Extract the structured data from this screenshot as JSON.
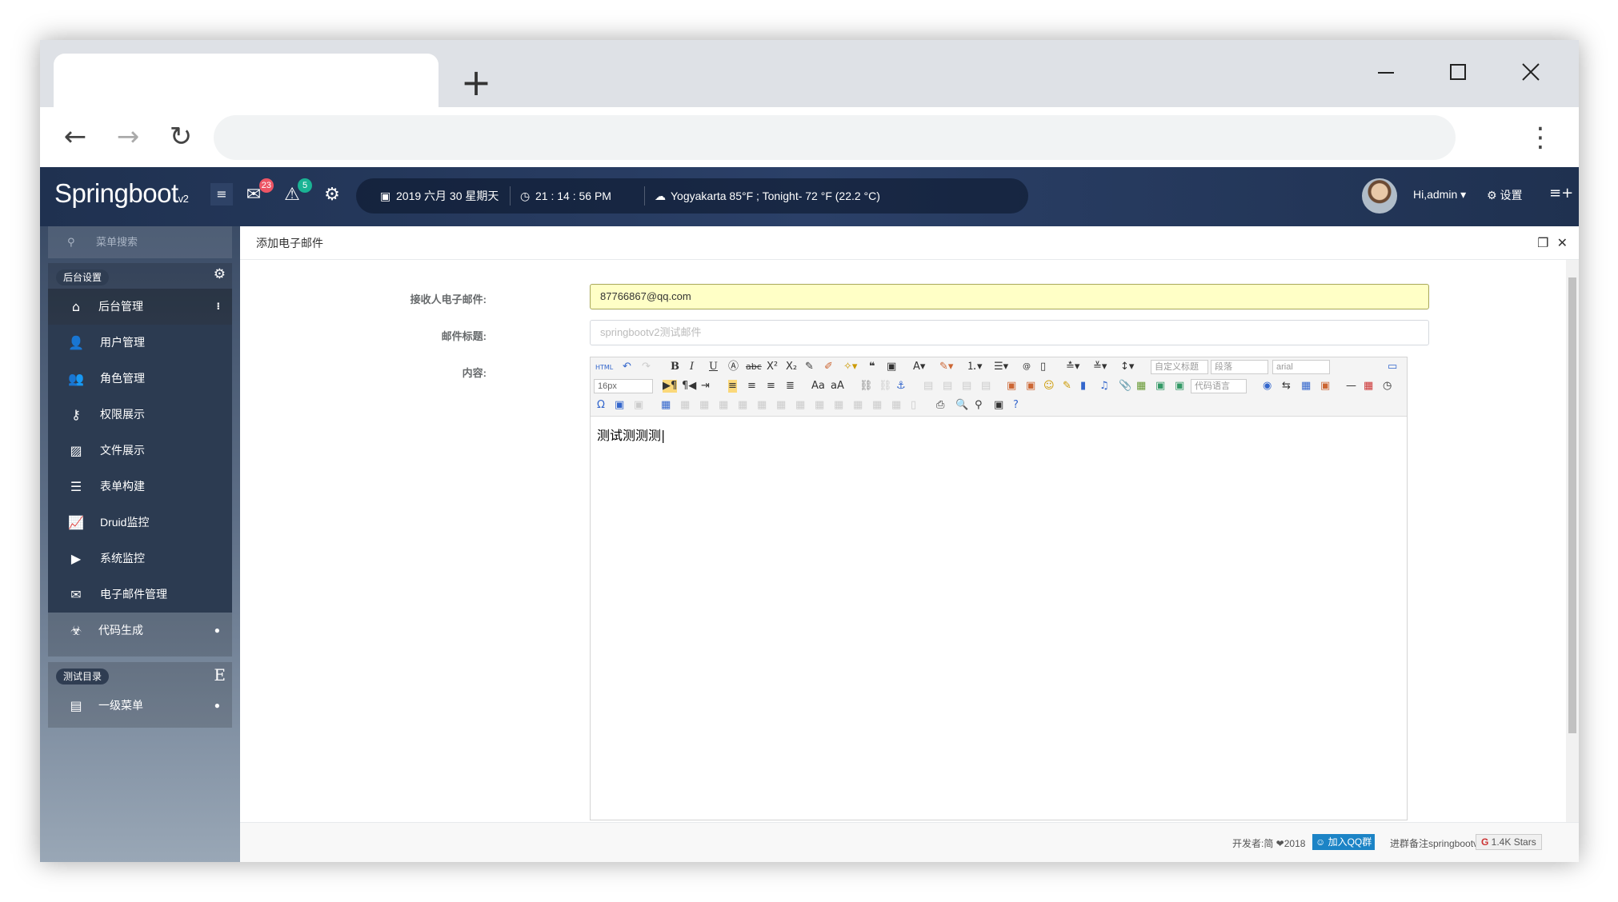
{
  "browser": {
    "new_tab": "+",
    "back": "←",
    "forward": "→",
    "reload": "↻",
    "menu": "⋮"
  },
  "header": {
    "brand": "Springboot",
    "brand_sub": "v2",
    "notify_count": "23",
    "alert_count": "5",
    "date": "2019 六月 30 星期天",
    "time": "21 : 14 : 56 PM",
    "weather": "Yogyakarta  85°F ; Tonight- 72 °F (22.2 °C)",
    "user": "Hi,admin ▾",
    "settings": "设置"
  },
  "sidebar": {
    "search_placeholder": "菜单搜索",
    "group1_label": "后台设置",
    "group1_head": "后台管理",
    "items": [
      {
        "label": "用户管理"
      },
      {
        "label": "角色管理"
      },
      {
        "label": "权限展示"
      },
      {
        "label": "文件展示"
      },
      {
        "label": "表单构建"
      },
      {
        "label": "Druid监控"
      },
      {
        "label": "系统监控"
      },
      {
        "label": "电子邮件管理"
      }
    ],
    "code_gen": "代码生成",
    "group2_label": "测试目录",
    "group2_item": "一级菜单"
  },
  "page": {
    "title": "添加电子邮件",
    "recipient_label": "接收人电子邮件:",
    "recipient_value": "87766867@qq.com",
    "subject_label": "邮件标题:",
    "subject_placeholder": "springbootv2测试邮件",
    "content_label": "内容:",
    "editor_text": "测试测测测",
    "editor_font_size": "16px",
    "editor_title_select": "自定义标题",
    "editor_para_select": "段落",
    "editor_font_select": "arial",
    "editor_code_select": "代码语言"
  },
  "footer": {
    "dev": "开发者:简 ❤2018",
    "qq_button": "加入QQ群",
    "note": "进群备注springbootv2",
    "stars": "1.4K Stars"
  },
  "colors": {
    "topbar": "#1f3150",
    "sidebar_dark": "#2c3b51",
    "input_highlight": "#ffffc6",
    "badge_red": "#ed5565",
    "badge_teal": "#1ab394",
    "qq_blue": "#1c84c6"
  }
}
